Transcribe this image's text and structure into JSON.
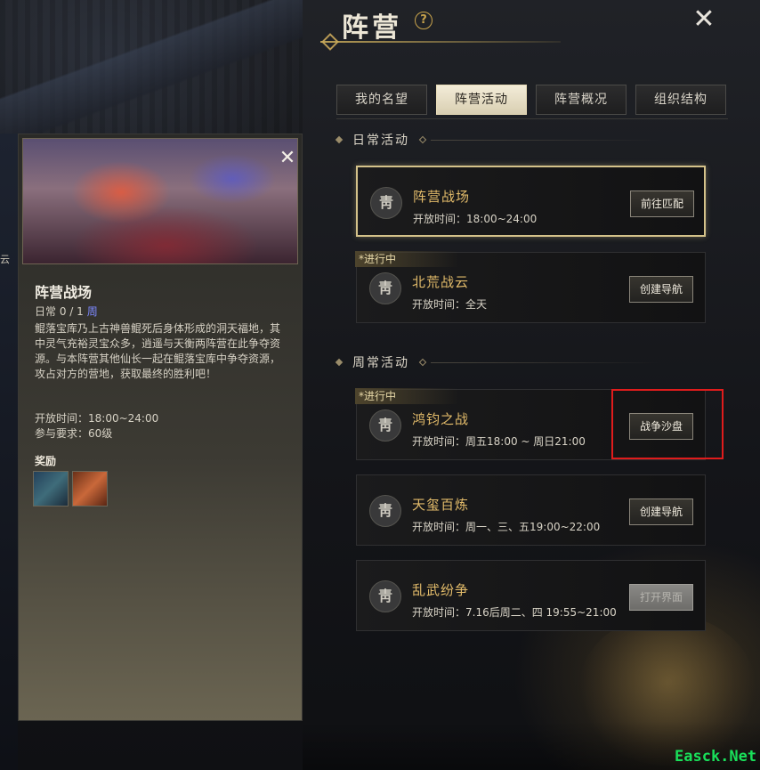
{
  "header": {
    "title": "阵营",
    "help_glyph": "?",
    "close_glyph": "✕"
  },
  "tabs": [
    {
      "label": "我的名望",
      "active": false
    },
    {
      "label": "阵营活动",
      "active": true
    },
    {
      "label": "阵营概况",
      "active": false
    },
    {
      "label": "组织结构",
      "active": false
    }
  ],
  "sections": {
    "daily": "日常活动",
    "weekly": "周常活动"
  },
  "activities": [
    {
      "name": "阵营战场",
      "time": "开放时间：18:00~24:00",
      "button": "前往匹配",
      "tag": "",
      "emblem": "靑"
    },
    {
      "name": "北荒战云",
      "time": "开放时间：全天",
      "button": "创建导航",
      "tag": "*进行中",
      "emblem": "靑"
    },
    {
      "name": "鸿钧之战",
      "time": "开放时间：周五18:00 ~ 周日21:00",
      "button": "战争沙盘",
      "tag": "*进行中",
      "emblem": "靑"
    },
    {
      "name": "天玺百炼",
      "time": "开放时间：周一、三、五19:00~22:00",
      "button": "创建导航",
      "tag": "",
      "emblem": "靑"
    },
    {
      "name": "乱武纷争",
      "time": "开放时间：7.16后周二、四 19:55~21:00",
      "button": "打开界面",
      "tag": "",
      "emblem": "靑"
    }
  ],
  "detail": {
    "title": "阵营战场",
    "count": "日常  0 / 1",
    "count_badge": "周",
    "close_glyph": "✕",
    "desc": "鲲落宝库乃上古神兽鲲死后身体形成的洞天福地，其中灵气充裕灵宝众多，逍遥与天衡两阵营在此争夺资源。与本阵营其他仙长一起在鲲落宝库中争夺资源，攻占对方的营地，获取最终的胜利吧！",
    "open_time": "开放时间：18:00~24:00",
    "requirement": "参与要求：60级",
    "reward_label": "奖励"
  },
  "side_hint": "云",
  "watermark": "Easck.Net",
  "colors": {
    "accent_gold": "#e2bb6a",
    "highlight_red": "#e01c1c",
    "watermark_green": "#19e05a"
  }
}
